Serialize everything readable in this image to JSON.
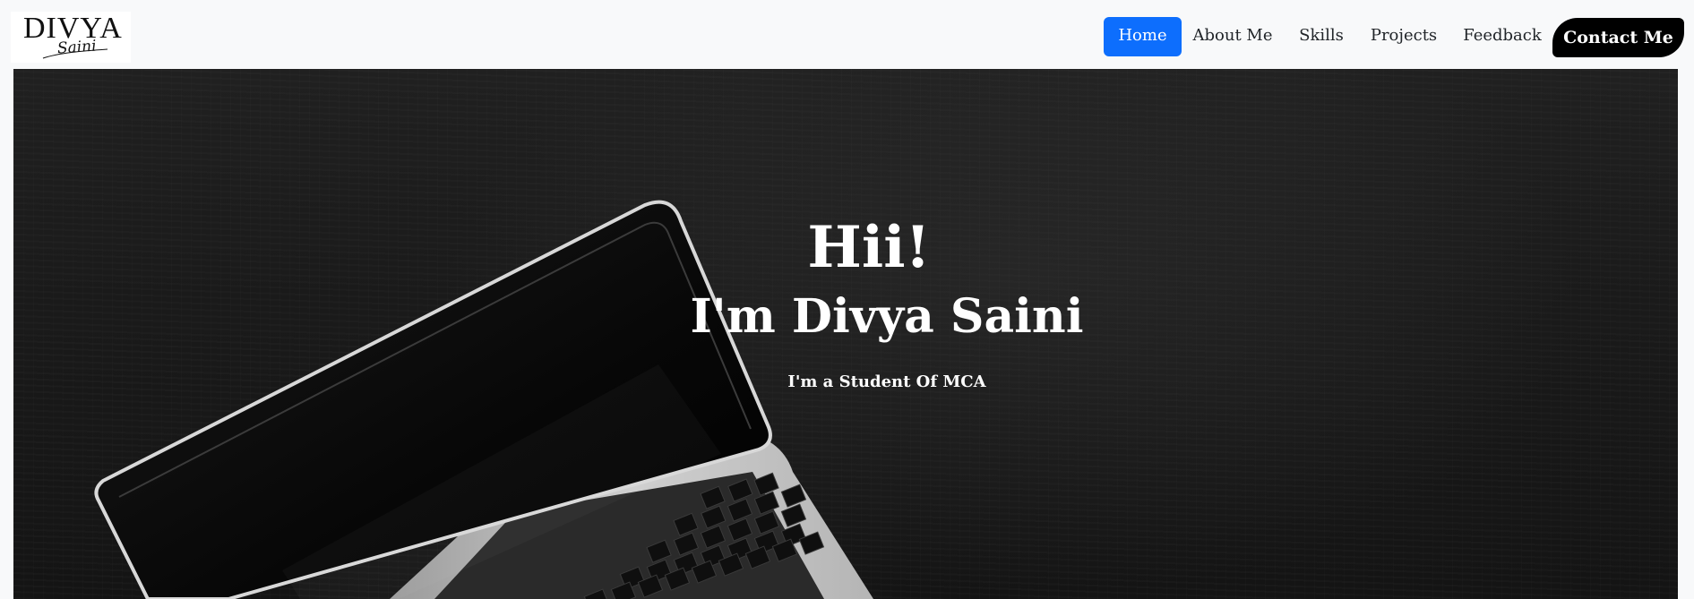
{
  "logo": {
    "text": "DIVYA",
    "script": "Saini"
  },
  "nav": {
    "items": [
      {
        "label": "Home",
        "active": true
      },
      {
        "label": "About Me",
        "active": false
      },
      {
        "label": "Skills",
        "active": false
      },
      {
        "label": "Projects",
        "active": false
      },
      {
        "label": "Feedback",
        "active": false
      }
    ],
    "cta": {
      "label": "Contact Me"
    }
  },
  "hero": {
    "greeting": "Hii!",
    "name": "I'm Divya Saini",
    "role": "I'm a Student Of MCA",
    "image": "laptop-on-dark-wood-background"
  },
  "colors": {
    "accent": "#0d6efd",
    "cta_background": "#000000",
    "hero_background": "#1b1b1b",
    "navbar_background": "#f8f9fa"
  }
}
